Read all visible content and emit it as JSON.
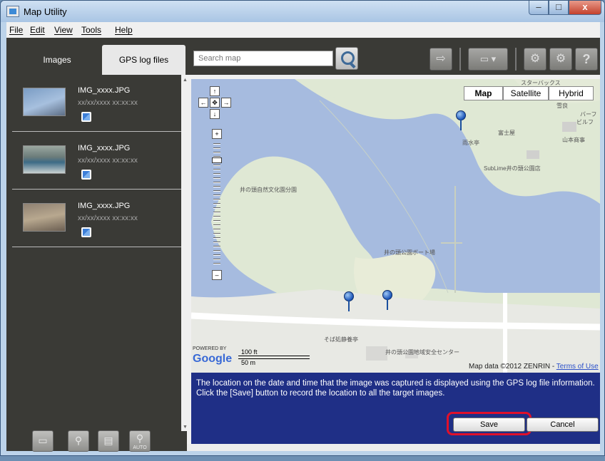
{
  "window": {
    "title": "Map Utility",
    "buttons": {
      "minimize": "–",
      "maximize": "□",
      "close": "x"
    }
  },
  "menu": {
    "items": [
      "File",
      "Edit",
      "View",
      "Tools",
      "Help"
    ]
  },
  "left_panel": {
    "tabs": [
      {
        "label": "Images",
        "active": true
      },
      {
        "label": "GPS log files",
        "active": false
      }
    ],
    "images": [
      {
        "name": "IMG_xxxx.JPG",
        "datetime": "xx/xx/xxxx xx:xx:xx",
        "gps_icon": "gps-tagged-icon"
      },
      {
        "name": "IMG_xxxx.JPG",
        "datetime": "xx/xx/xxxx xx:xx:xx",
        "gps_icon": "gps-tagged-icon"
      },
      {
        "name": "IMG_xxxx.JPG",
        "datetime": "xx/xx/xxxx xx:xx:xx",
        "gps_icon": "gps-tagged-icon"
      }
    ],
    "bottom_tools": [
      {
        "icon": "folder-icon",
        "glyph": "▭"
      },
      {
        "icon": "remove-location-icon",
        "glyph": "⚲"
      },
      {
        "icon": "copy-location-icon",
        "glyph": "▤"
      },
      {
        "icon": "auto-location-icon",
        "glyph": "⚲",
        "sub": "AUTO"
      }
    ]
  },
  "toolbar": {
    "search_placeholder": "Search map",
    "buttons": [
      {
        "icon": "export-icon",
        "glyph": "⇨"
      },
      {
        "icon": "window-dropdown-icon",
        "glyph": "▭ ▾"
      },
      {
        "icon": "tools-settings-icon",
        "glyph": "⚙"
      },
      {
        "icon": "gear-icon",
        "glyph": "⚙"
      },
      {
        "icon": "help-icon",
        "glyph": "?"
      }
    ]
  },
  "map": {
    "type_buttons": [
      {
        "label": "Map",
        "active": true
      },
      {
        "label": "Satellite",
        "active": false
      },
      {
        "label": "Hybrid",
        "active": false
      }
    ],
    "pan": {
      "up": "↑",
      "left": "←",
      "center": "✥",
      "right": "→",
      "down": "↓"
    },
    "zoom": {
      "in": "+",
      "out": "–"
    },
    "labels": [
      "井の頭自然文化園分園",
      "井の頭公園ボート場",
      "そば処静養亭",
      "井の頭公園地域安全センター",
      "富士屋",
      "雨水亭",
      "SubLime井の頭公園店",
      "山本商事",
      "スターバックス",
      "ビルフ",
      "バーフ",
      "雪良"
    ],
    "scale": {
      "feet": "100 ft",
      "meters": "50 m"
    },
    "powered_by": "POWERED BY",
    "google": "Google",
    "attribution": "Map data ©2012 ZENRIN - ",
    "terms": "Terms of Use"
  },
  "info": {
    "message": "The location on the date and time that the image was captured is displayed using the GPS log file information. Click the [Save] button to record the location to all the target images.",
    "save": "Save",
    "cancel": "Cancel"
  },
  "colors": {
    "panel_dark": "#3a3a36",
    "info_blue": "#1f2f86",
    "highlight_red": "#e0102a",
    "water": "#a6bbdf"
  }
}
